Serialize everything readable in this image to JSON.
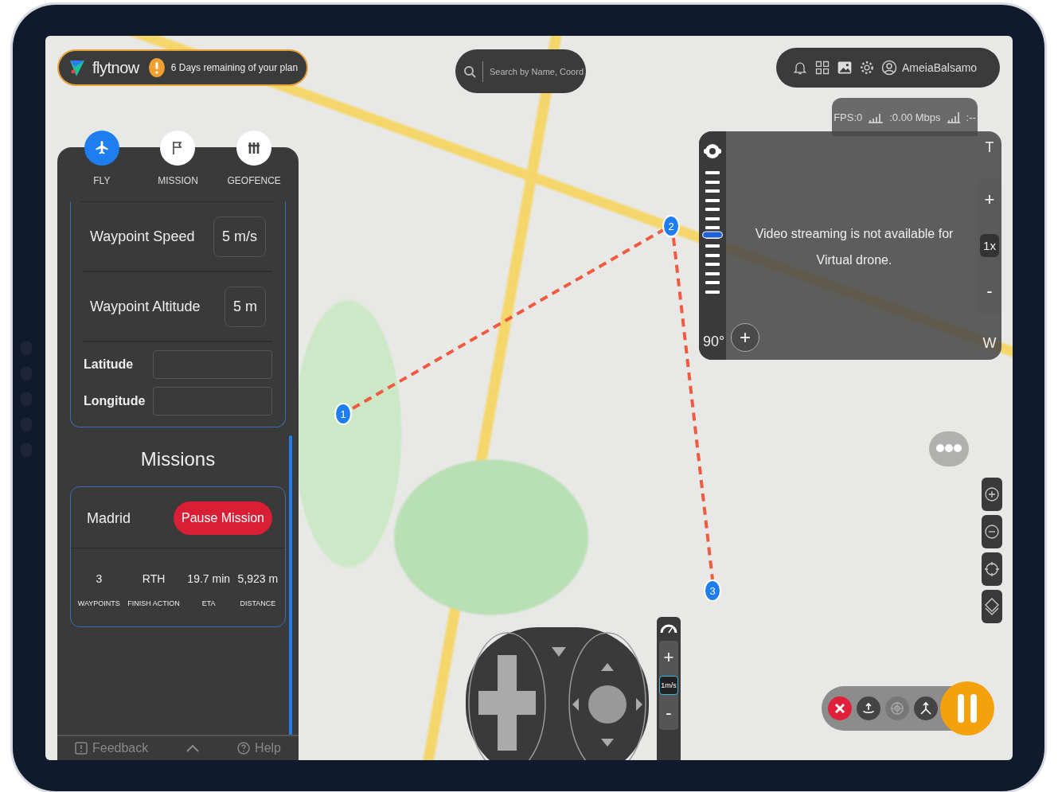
{
  "header": {
    "brand": "flytnow",
    "notice": "6 Days remaining of your plan"
  },
  "search": {
    "placeholder": "Search by Name, Coord"
  },
  "toolbar": {
    "user": "AmeiaBalsamo"
  },
  "nav_tabs": [
    {
      "label": "FLY",
      "selected": true
    },
    {
      "label": "MISSION",
      "selected": false
    },
    {
      "label": "GEOFENCE",
      "selected": false
    }
  ],
  "settings": [
    {
      "label": "Waypoint Speed",
      "value": "5 m/s"
    },
    {
      "label": "Waypoint Altitude",
      "value": "5 m"
    }
  ],
  "coordinates": [
    {
      "label": "Latitude"
    },
    {
      "label": "Longitude"
    }
  ],
  "missions": {
    "title": "Missions",
    "name": "Madrid",
    "action": "Pause Mission",
    "stats": [
      {
        "value": "3",
        "label": "WAYPOINTS"
      },
      {
        "value": "RTH",
        "label": "FINISH ACTION"
      },
      {
        "value": "19.7 min",
        "label": "ETA"
      },
      {
        "value": "5,923 m",
        "label": "DISTANCE"
      }
    ]
  },
  "footer": {
    "feedback": "Feedback",
    "help": "Help"
  },
  "video": {
    "fps": "FPS:0",
    "bitrate": ":0.00 Mbps",
    "signal": ":--",
    "message": "Video streaming is not available for Virtual drone.",
    "gimbal_angle": "90°",
    "gimbal_slider": {
      "level": 0.5
    },
    "add": "+",
    "zoom_top": "T",
    "zoom_in": "+",
    "zoom_level": "1x",
    "zoom_out": "-",
    "zoom_bottom": "W"
  },
  "waypoints": [
    "1",
    "2",
    "3"
  ],
  "speed": {
    "up": "+",
    "value": "1m/s",
    "down": "-"
  }
}
